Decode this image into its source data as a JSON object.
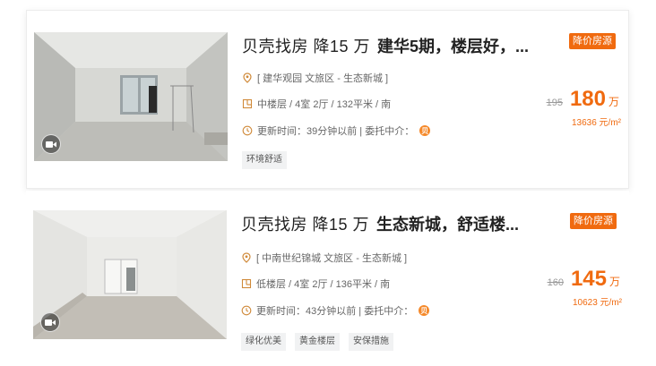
{
  "listings": [
    {
      "title_prefix": "贝壳找房 降15 万",
      "title_main": "建华5期，楼层好，...",
      "community": "[ 建华观园 文旅区 - 生态新城 ]",
      "details": "中楼层 / 4室 2厅 / 132平米 / 南",
      "updated": "更新时间：39分钟以前 | 委托中介：",
      "weituo_icon_text": "贝",
      "tags": [
        "环境舒适"
      ],
      "badge": "降价房源",
      "old_price": "195",
      "price": "180",
      "price_unit": "万",
      "unit_price": "13636 元/m²"
    },
    {
      "title_prefix": "贝壳找房 降15 万",
      "title_main": "生态新城，舒适楼...",
      "community": "[ 中南世纪锦城 文旅区 - 生态新城 ]",
      "details": "低楼层 / 4室 2厅 / 136平米 / 南",
      "updated": "更新时间：43分钟以前 | 委托中介：",
      "weituo_icon_text": "贝",
      "tags": [
        "绿化优美",
        "黄金楼层",
        "安保措施"
      ],
      "badge": "降价房源",
      "old_price": "160",
      "price": "145",
      "price_unit": "万",
      "unit_price": "10623 元/m²"
    }
  ],
  "icons": {
    "location": "location-pin-icon",
    "layout": "floorplan-icon",
    "time": "clock-icon",
    "video": "video-camera-icon"
  },
  "colors": {
    "accent": "#f06a0f",
    "tag_bg": "#f1f2f3"
  }
}
